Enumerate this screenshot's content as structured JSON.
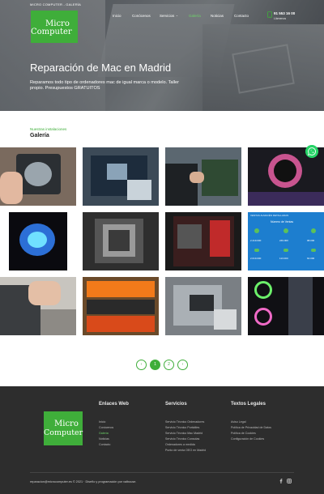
{
  "topbar": {
    "text": "MICRO COMPUTER - GALERÍA"
  },
  "logo": {
    "line1": "Micro",
    "line2": "Computer"
  },
  "nav": {
    "items": [
      {
        "label": "Inicio"
      },
      {
        "label": "Conócenos"
      },
      {
        "label": "Servicios"
      },
      {
        "label": "Galería"
      },
      {
        "label": "Noticias"
      },
      {
        "label": "Contacto"
      }
    ],
    "active": "Galería"
  },
  "contact": {
    "phone": "91 553 16 00",
    "sub": "Llámenos"
  },
  "hero": {
    "title": "Reparación de Mac en Madrid",
    "text": "Reparamos todo tipo de ordenadores mac de igual marca o modelo. Taller propio. Presupuestos GRATUITOS"
  },
  "section": {
    "kicker": "Nuestras instalaciones",
    "title": "Galería"
  },
  "gallery": {
    "images": [
      {
        "name": "hands-cpu-cooler"
      },
      {
        "name": "motherboard-blue"
      },
      {
        "name": "technician-repair"
      },
      {
        "name": "rgb-fan-build"
      },
      {
        "name": "blue-fan-screen"
      },
      {
        "name": "cpu-cooler-closeup"
      },
      {
        "name": "red-motherboard"
      },
      {
        "name": "sales-dashboard"
      },
      {
        "name": "cables-assembly"
      },
      {
        "name": "shop-shelves"
      },
      {
        "name": "laptop-internals"
      },
      {
        "name": "rgb-tower"
      }
    ],
    "dashboard": {
      "header": "VENTAS ALMACÉN DETALLADAS",
      "box_title": "Número de Ventas",
      "values": [
        "2.419.000",
        "249.000",
        "98.000",
        "2.019.000",
        "113.000",
        "64.000"
      ]
    }
  },
  "pagination": {
    "prev": "‹",
    "pages": [
      "1",
      "2"
    ],
    "next": "›",
    "current": "1"
  },
  "footer": {
    "col1": {
      "title": "Enlaces Web",
      "links": [
        "Inicio",
        "Conócenos",
        "Galería",
        "Noticias",
        "Contacto"
      ],
      "active": "Galería"
    },
    "col2": {
      "title": "Servicios",
      "links": [
        "Servicio Técnico Ordenadores",
        "Servicio Técnico Portátiles",
        "Servicio Técnico Mac Madrid",
        "Servicio Técnico Consolas",
        "Ordenadores a medida",
        "Punto de venta OEO en Madrid"
      ]
    },
    "col3": {
      "title": "Textos Legales",
      "links": [
        "Aviso Legal",
        "Política de Privacidad de Datos",
        "Política de Cookies",
        "Configuración de Cookies"
      ]
    },
    "copyright": "reparacion@microcomputer.es © 2021 · Diseño y programación por valbouse."
  },
  "colors": {
    "brand_green": "#3fae3a",
    "footer_bg": "#2d2d2d",
    "whatsapp": "#25d366"
  },
  "icons": {
    "phone": "phone-icon",
    "whatsapp": "whatsapp-icon",
    "facebook": "facebook-icon",
    "instagram": "instagram-icon"
  }
}
